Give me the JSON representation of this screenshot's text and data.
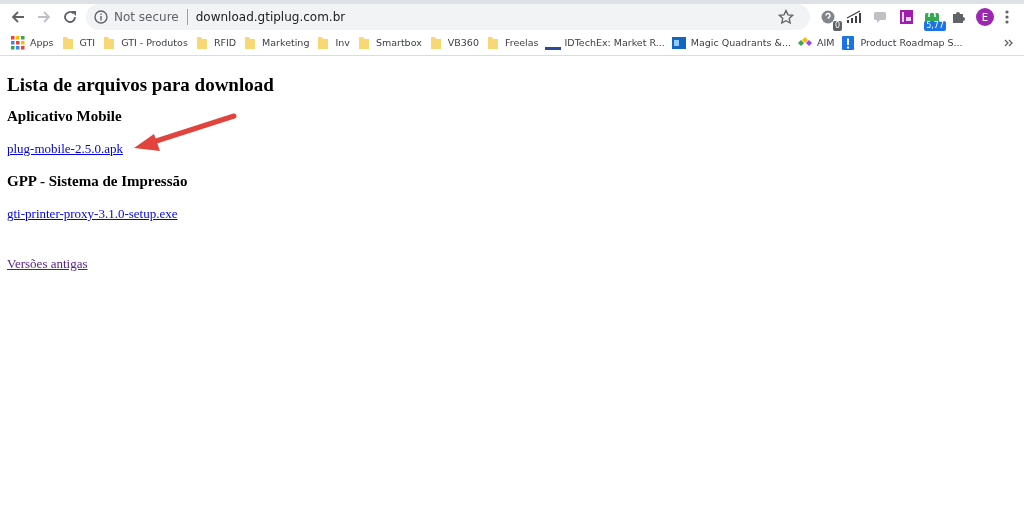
{
  "browser": {
    "security_label": "Not secure",
    "url": "download.gtiplug.com.br",
    "extensions": [
      {
        "kind": "help",
        "badge": "0"
      },
      {
        "kind": "signal"
      },
      {
        "kind": "chat"
      },
      {
        "kind": "rp"
      },
      {
        "kind": "lock",
        "badge": "5,77"
      },
      {
        "kind": "puzzle"
      }
    ],
    "avatar": "E"
  },
  "bookmarks": [
    {
      "kind": "apps",
      "label": "Apps"
    },
    {
      "kind": "folder",
      "label": "GTI"
    },
    {
      "kind": "folder",
      "label": "GTI - Produtos"
    },
    {
      "kind": "folder",
      "label": "RFID"
    },
    {
      "kind": "folder",
      "label": "Marketing"
    },
    {
      "kind": "folder",
      "label": "Inv"
    },
    {
      "kind": "folder",
      "label": "Smartbox"
    },
    {
      "kind": "folder",
      "label": "VB360"
    },
    {
      "kind": "folder",
      "label": "Freelas"
    },
    {
      "kind": "bar",
      "label": "IDTechEx: Market R..."
    },
    {
      "kind": "square",
      "label": "Magic Quadrants &..."
    },
    {
      "kind": "diamonds",
      "label": "AIM"
    },
    {
      "kind": "alert",
      "label": "Product Roadmap S..."
    }
  ],
  "page": {
    "title": "Lista de arquivos para download",
    "sections": [
      {
        "heading": "Aplicativo Mobile",
        "link": {
          "text": "plug-mobile-2.5.0.apk",
          "visited": false
        }
      },
      {
        "heading": "GPP - Sistema de Impressão",
        "link": {
          "text": "gti-printer-proxy-3.1.0-setup.exe",
          "visited": false
        }
      }
    ],
    "footer_link": {
      "text": "Versões antigas",
      "visited": true
    }
  }
}
